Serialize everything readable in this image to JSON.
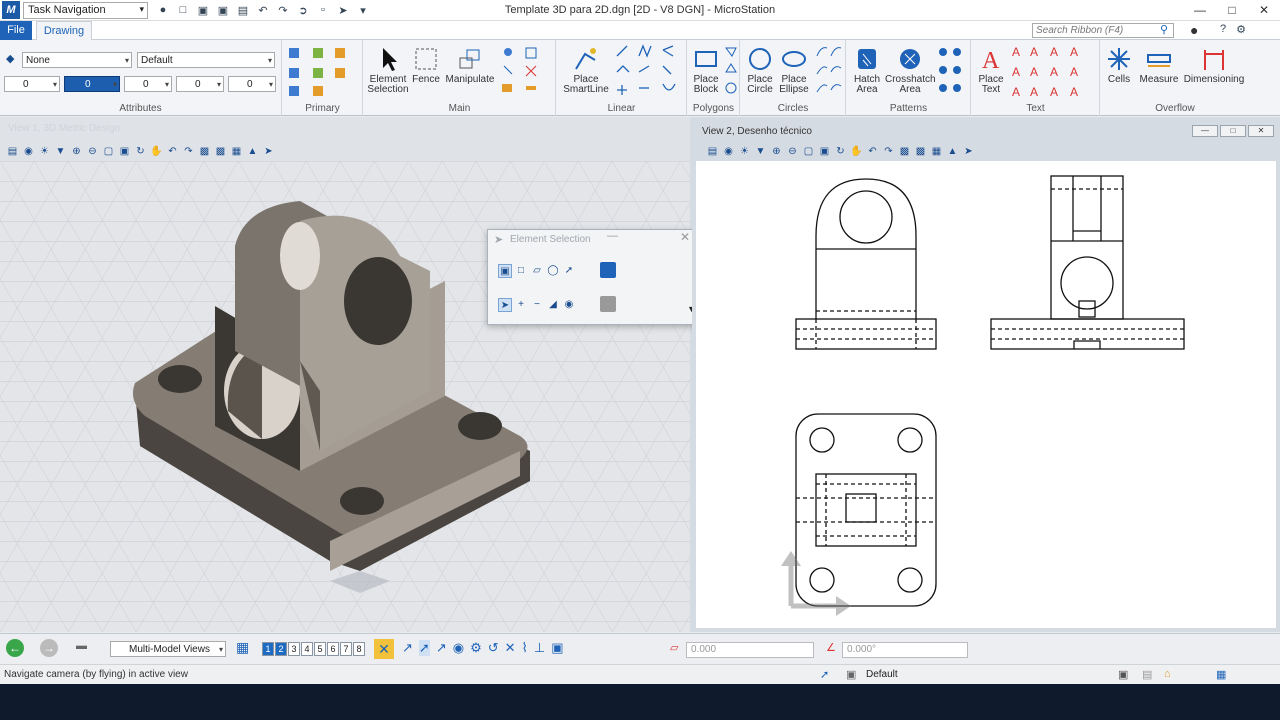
{
  "titlebar": {
    "task_navigation": "Task Navigation",
    "window_title": "Template 3D para 2D.dgn [2D - V8 DGN] - MicroStation"
  },
  "tabs": {
    "file": "File",
    "drawing": "Drawing"
  },
  "search": {
    "placeholder": "Search Ribbon (F4)"
  },
  "attributes": {
    "level": "None",
    "style": "Default",
    "color": "0",
    "weight": "0",
    "transparency": "0",
    "priority": "0",
    "group_label": "Attributes"
  },
  "ribbon": {
    "groups": {
      "primary": "Primary",
      "main": "Main",
      "linear": "Linear",
      "polygons": "Polygons",
      "circles": "Circles",
      "patterns": "Patterns",
      "text": "Text",
      "overflow": "Overflow"
    },
    "buttons": {
      "element_selection": "Element\nSelection",
      "fence": "Fence",
      "manipulate": "Manipulate",
      "place_smartline": "Place\nSmartLine",
      "place_block": "Place\nBlock",
      "place_circle": "Place\nCircle",
      "place_ellipse": "Place\nEllipse",
      "hatch_area": "Hatch\nArea",
      "crosshatch_area": "Crosshatch\nArea",
      "place_text": "Place\nText",
      "cells": "Cells",
      "measure": "Measure",
      "dimensioning": "Dimensioning"
    }
  },
  "view1": {
    "title": "View 1, 3D Metric Design"
  },
  "view2": {
    "title": "View 2, Desenho técnico"
  },
  "element_selection": {
    "title": "Element Selection"
  },
  "bottombar": {
    "model_views": "Multi-Model Views",
    "view_numbers": [
      "1",
      "2",
      "3",
      "4",
      "5",
      "6",
      "7",
      "8"
    ],
    "x_value": "0.000",
    "angle_value": "0.000°",
    "level": "Default"
  },
  "status": {
    "prompt": "Navigate camera (by flying) in active view"
  },
  "colors": {
    "accent": "#1e63b8",
    "taskbar": "#0f1b2c"
  }
}
